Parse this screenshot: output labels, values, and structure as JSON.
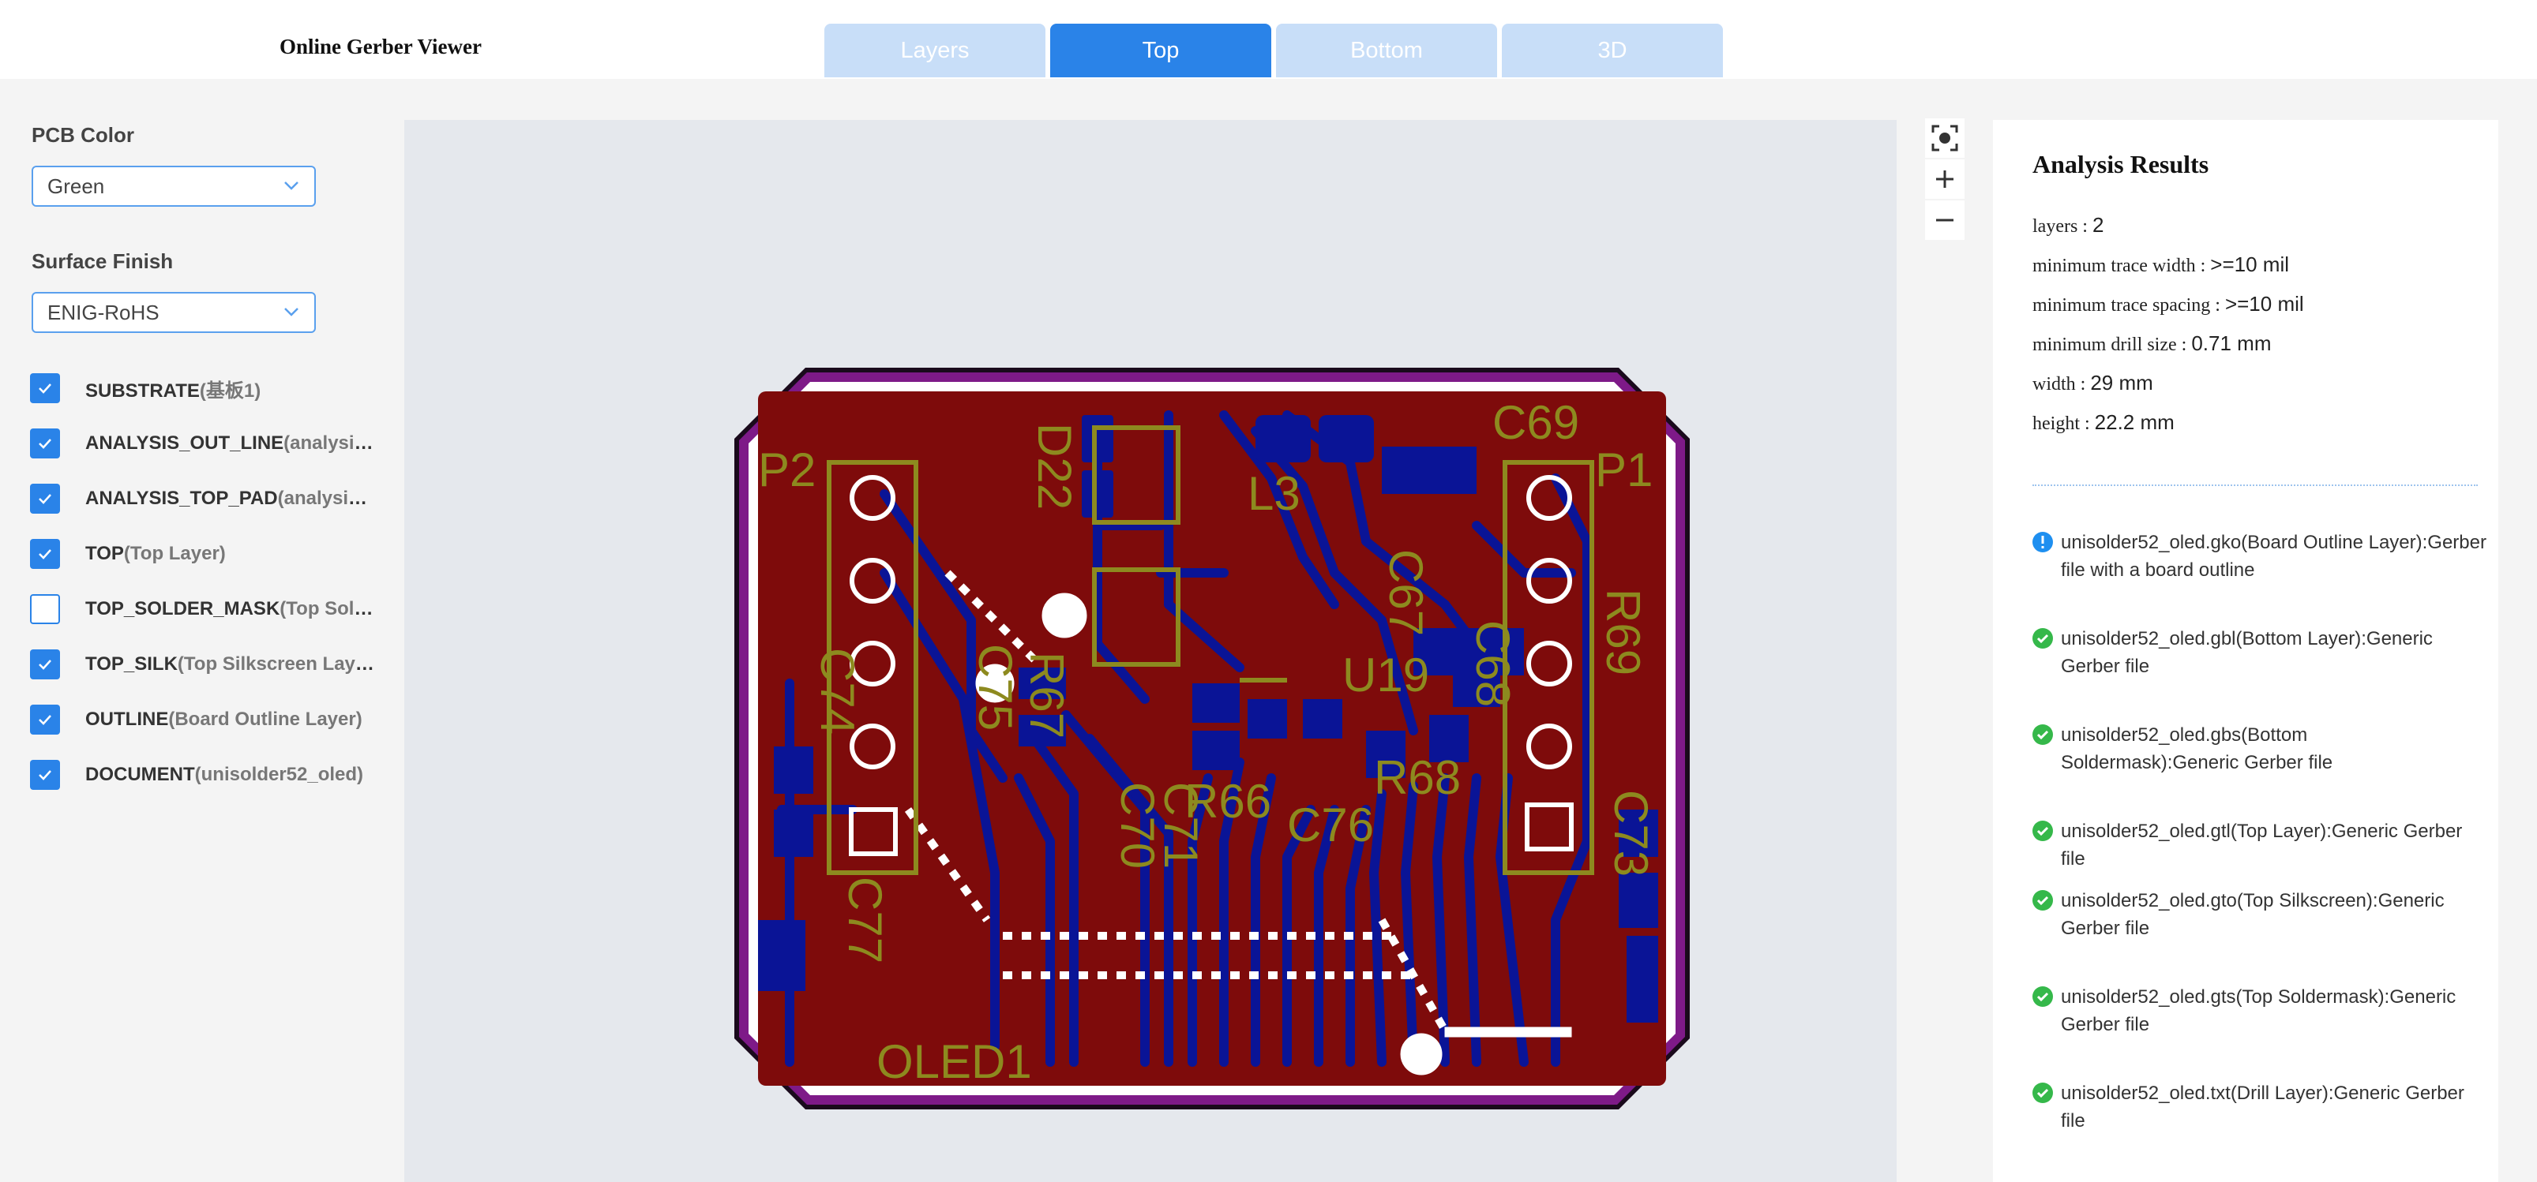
{
  "app": {
    "title": "Online Gerber Viewer"
  },
  "tabs": [
    {
      "label": "Layers",
      "active": false
    },
    {
      "label": "Top",
      "active": true
    },
    {
      "label": "Bottom",
      "active": false
    },
    {
      "label": "3D",
      "active": false
    }
  ],
  "sidebar": {
    "pcb_color_label": "PCB Color",
    "pcb_color_value": "Green",
    "surface_finish_label": "Surface Finish",
    "surface_finish_value": "ENIG-RoHS",
    "layers": [
      {
        "name": "SUBSTRATE",
        "sub": "(基板1)",
        "checked": true
      },
      {
        "name": "ANALYSIS_OUT_LINE",
        "sub": "(analysis_out_line)",
        "checked": true
      },
      {
        "name": "ANALYSIS_TOP_PAD",
        "sub": "(analysis_top_pad)",
        "checked": true
      },
      {
        "name": "TOP",
        "sub": "(Top Layer)",
        "checked": true
      },
      {
        "name": "TOP_SOLDER_MASK",
        "sub": "(Top Soldermask)",
        "checked": false
      },
      {
        "name": "TOP_SILK",
        "sub": "(Top Silkscreen Layer)",
        "checked": true
      },
      {
        "name": "OUTLINE",
        "sub": "(Board Outline Layer)",
        "checked": true
      },
      {
        "name": "DOCUMENT",
        "sub": "(unisolder52_oled)",
        "checked": true
      }
    ]
  },
  "pcb": {
    "labels": [
      "P2",
      "D22",
      "L3",
      "C69",
      "P1",
      "C67",
      "R69",
      "C74",
      "C75",
      "R67",
      "U19",
      "C68",
      "R66",
      "C76",
      "R68",
      "C70",
      "C71",
      "C73",
      "C77",
      "OLED1"
    ]
  },
  "view_controls": [
    "fit-view",
    "zoom-in",
    "zoom-out"
  ],
  "results": {
    "title": "Analysis Results",
    "stats": [
      {
        "key": "layers : ",
        "value": "2"
      },
      {
        "key": "minimum trace width : ",
        "value": ">=10 mil"
      },
      {
        "key": "minimum trace spacing : ",
        "value": ">=10 mil"
      },
      {
        "key": "minimum drill size : ",
        "value": "0.71 mm"
      },
      {
        "key": "width : ",
        "value": "29 mm"
      },
      {
        "key": "height : ",
        "value": "22.2 mm"
      }
    ],
    "files": [
      {
        "status": "info",
        "text": "unisolder52_oled.gko(Board Outline Layer):Gerber file with a board outline"
      },
      {
        "status": "ok",
        "text": "unisolder52_oled.gbl(Bottom Layer):Generic Gerber file"
      },
      {
        "status": "ok",
        "text": "unisolder52_oled.gbs(Bottom Soldermask):Generic Gerber file"
      },
      {
        "status": "ok",
        "text": "unisolder52_oled.gtl(Top Layer):Generic Gerber file"
      },
      {
        "status": "ok",
        "text": "unisolder52_oled.gto(Top Silkscreen):Generic Gerber file"
      },
      {
        "status": "ok",
        "text": "unisolder52_oled.gts(Top Soldermask):Generic Gerber file"
      },
      {
        "status": "ok",
        "text": "unisolder52_oled.txt(Drill Layer):Generic Gerber file"
      }
    ],
    "colors": {
      "ok": "#35b84a",
      "info": "#1e8ff0"
    }
  },
  "colors": {
    "accent": "#2a83e8",
    "tab_inactive": "#c8def8",
    "board": "#7e0b0b",
    "trace": "#0a1496",
    "silk": "#8d8a1f",
    "outline": "#7e1a88"
  }
}
